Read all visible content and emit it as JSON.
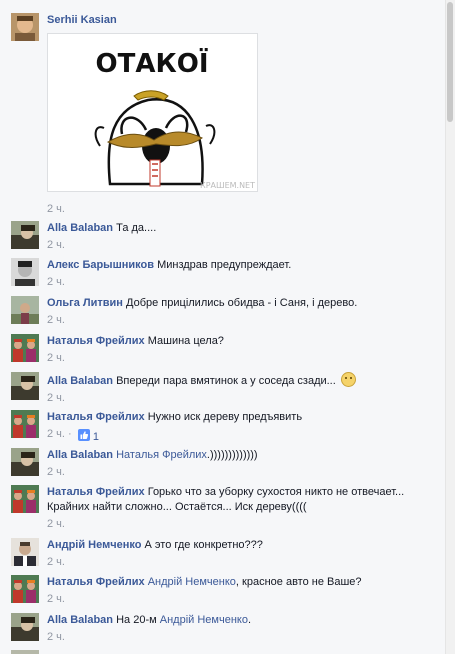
{
  "comments": [
    {
      "author": "Serhii Kasian",
      "text": "",
      "time": "2 ч.",
      "sticker_text": "ОТАКОЇ",
      "sticker_watermark": "КРАШЕМ.NET"
    },
    {
      "author": "Alla Balaban",
      "text": "Та да....",
      "time": "2 ч."
    },
    {
      "author": "Алекс Барышников",
      "text": "Минздрав предупреждает.",
      "time": "2 ч."
    },
    {
      "author": "Ольга Литвин",
      "text": "Добре прицілились обидва - і Саня, і дерево.",
      "time": "2 ч."
    },
    {
      "author": "Наталья Фрейлих",
      "text": "Машина цела?",
      "time": "2 ч."
    },
    {
      "author": "Alla Balaban",
      "text": "Впереди пара вмятинок а у соседа сзади...",
      "time": "2 ч.",
      "emoji": "frown-emoji"
    },
    {
      "author": "Наталья Фрейлих",
      "text": "Нужно иск дереву предъявить",
      "time": "2 ч.",
      "separator": "·",
      "likes": "1"
    },
    {
      "author": "Alla Balaban",
      "mention": "Наталья Фрейлих",
      "text": ".)))))))))))))",
      "time": "2 ч."
    },
    {
      "author": "Наталья Фрейлих",
      "text": "Горько что за уборку сухостоя никто не отвечает...",
      "text2": "Крайних найти сложно... Остаётся... Иск дереву((((",
      "time": "2 ч."
    },
    {
      "author": "Андрій Немченко",
      "text": "А это где конкретно???",
      "time": "2 ч."
    },
    {
      "author": "Наталья Фрейлих",
      "mention": "Андрій Немченко",
      "text": ", красное авто не Ваше?",
      "time": "2 ч."
    },
    {
      "author": "Alla Balaban",
      "prefix": "На 20-м",
      "mention": "Андрій Немченко",
      "text": ".",
      "time": "2 ч."
    }
  ]
}
